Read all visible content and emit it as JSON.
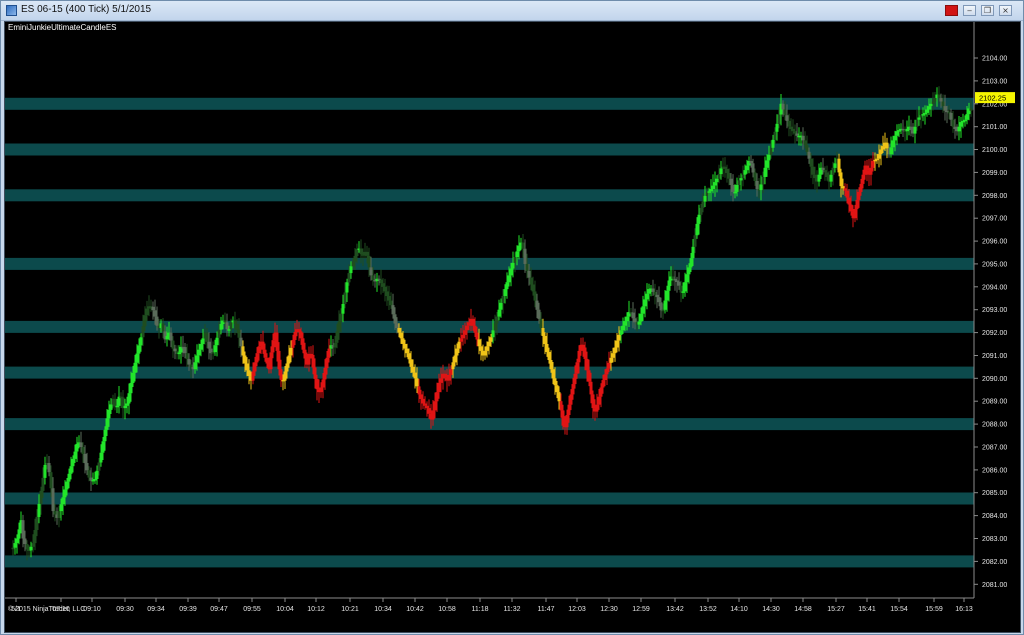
{
  "window": {
    "title": "ES 06-15 (400 Tick)  5/1/2015",
    "minimize_glyph": "‒",
    "restore_glyph": "❐",
    "close_glyph": "×",
    "accent_color": "#d11414"
  },
  "chart": {
    "indicator_label": "EminiJunkieUltimateCandleES",
    "copyright": "© 2015 NinjaTrader, LLC",
    "current_price_label": "2102.25",
    "level_band_color": "#0c4a4c",
    "background_color": "#000000",
    "price_tag_color": "#f5f500"
  },
  "chart_data": {
    "type": "candlestick",
    "instrument": "ES 06-15",
    "period": "400 Tick",
    "date": "5/1/2015",
    "y_axis": {
      "range": [
        2080.4,
        2104.7
      ],
      "ticks": [
        "2081.00",
        "2082.00",
        "2083.00",
        "2084.00",
        "2085.00",
        "2086.00",
        "2087.00",
        "2088.00",
        "2089.00",
        "2090.00",
        "2091.00",
        "2092.00",
        "2093.00",
        "2094.00",
        "2095.00",
        "2096.00",
        "2097.00",
        "2098.00",
        "2099.00",
        "2100.00",
        "2101.00",
        "2102.00",
        "2103.00",
        "2104.00"
      ]
    },
    "x_axis": {
      "ticks": [
        "5/1",
        "07:10",
        "09:10",
        "09:30",
        "09:34",
        "09:39",
        "09:47",
        "09:55",
        "10:04",
        "10:12",
        "10:21",
        "10:34",
        "10:42",
        "10:58",
        "11:18",
        "11:32",
        "11:47",
        "12:03",
        "12:30",
        "12:59",
        "13:42",
        "13:52",
        "14:10",
        "14:30",
        "14:58",
        "15:27",
        "15:41",
        "15:54",
        "15:59",
        "16:13"
      ]
    },
    "horizontal_levels": [
      2082.0,
      2084.75,
      2088.0,
      2090.25,
      2092.25,
      2095.0,
      2098.0,
      2100.0,
      2102.0
    ],
    "last_price": 2102.25,
    "path": [
      [
        0,
        2082.6
      ],
      [
        4,
        2083.0
      ],
      [
        8,
        2083.8
      ],
      [
        10,
        2083.0
      ],
      [
        15,
        2082.4
      ],
      [
        20,
        2082.8
      ],
      [
        27,
        2084.8
      ],
      [
        33,
        2086.5
      ],
      [
        37,
        2085.7
      ],
      [
        40,
        2084.2
      ],
      [
        44,
        2083.9
      ],
      [
        50,
        2084.8
      ],
      [
        57,
        2086.0
      ],
      [
        62,
        2086.8
      ],
      [
        65,
        2087.3
      ],
      [
        69,
        2086.9
      ],
      [
        72,
        2086.3
      ],
      [
        77,
        2085.5
      ],
      [
        82,
        2085.6
      ],
      [
        87,
        2086.5
      ],
      [
        91,
        2087.5
      ],
      [
        95,
        2088.5
      ],
      [
        100,
        2089.1
      ],
      [
        103,
        2088.6
      ],
      [
        107,
        2089.4
      ],
      [
        110,
        2088.7
      ],
      [
        114,
        2088.9
      ],
      [
        118,
        2089.8
      ],
      [
        123,
        2090.9
      ],
      [
        128,
        2091.8
      ],
      [
        133,
        2093.0
      ],
      [
        137,
        2093.2
      ],
      [
        141,
        2092.9
      ],
      [
        145,
        2092.1
      ],
      [
        148,
        2092.4
      ],
      [
        152,
        2091.7
      ],
      [
        156,
        2092.0
      ],
      [
        160,
        2091.3
      ],
      [
        165,
        2091.0
      ],
      [
        169,
        2091.5
      ],
      [
        172,
        2091.1
      ],
      [
        176,
        2090.6
      ],
      [
        180,
        2090.4
      ],
      [
        184,
        2091.0
      ],
      [
        188,
        2091.5
      ],
      [
        192,
        2092.0
      ],
      [
        195,
        2091.4
      ],
      [
        199,
        2091.0
      ],
      [
        203,
        2091.6
      ],
      [
        207,
        2092.3
      ],
      [
        211,
        2092.6
      ],
      [
        215,
        2092.0
      ],
      [
        219,
        2092.6
      ],
      [
        223,
        2092.3
      ],
      [
        227,
        2091.6
      ],
      [
        231,
        2090.8
      ],
      [
        235,
        2090.2
      ],
      [
        238,
        2089.9
      ],
      [
        241,
        2090.5
      ],
      [
        245,
        2091.3
      ],
      [
        248,
        2091.6
      ],
      [
        252,
        2090.9
      ],
      [
        256,
        2090.4
      ],
      [
        259,
        2091.5
      ],
      [
        262,
        2092.0
      ],
      [
        266,
        2090.4
      ],
      [
        269,
        2089.7
      ],
      [
        272,
        2090.3
      ],
      [
        276,
        2091.0
      ],
      [
        279,
        2091.5
      ],
      [
        283,
        2092.2
      ],
      [
        287,
        2092.0
      ],
      [
        291,
        2091.0
      ],
      [
        294,
        2090.6
      ],
      [
        297,
        2091.3
      ],
      [
        301,
        2090.2
      ],
      [
        305,
        2089.3
      ],
      [
        309,
        2089.7
      ],
      [
        313,
        2090.7
      ],
      [
        317,
        2091.5
      ],
      [
        321,
        2091.3
      ],
      [
        325,
        2092.3
      ],
      [
        329,
        2093.0
      ],
      [
        333,
        2094.0
      ],
      [
        337,
        2094.8
      ],
      [
        341,
        2095.2
      ],
      [
        345,
        2095.8
      ],
      [
        349,
        2095.3
      ],
      [
        353,
        2095.6
      ],
      [
        357,
        2094.6
      ],
      [
        361,
        2094.2
      ],
      [
        365,
        2094.4
      ],
      [
        370,
        2094.0
      ],
      [
        374,
        2093.6
      ],
      [
        378,
        2093.2
      ],
      [
        382,
        2092.4
      ],
      [
        386,
        2092.0
      ],
      [
        390,
        2091.5
      ],
      [
        395,
        2091.0
      ],
      [
        398,
        2090.5
      ],
      [
        402,
        2090.0
      ],
      [
        406,
        2089.3
      ],
      [
        410,
        2088.9
      ],
      [
        414,
        2088.7
      ],
      [
        418,
        2088.2
      ],
      [
        422,
        2089.0
      ],
      [
        426,
        2089.8
      ],
      [
        430,
        2090.2
      ],
      [
        434,
        2089.9
      ],
      [
        438,
        2090.4
      ],
      [
        442,
        2091.0
      ],
      [
        446,
        2091.6
      ],
      [
        450,
        2091.9
      ],
      [
        454,
        2092.3
      ],
      [
        458,
        2092.6
      ],
      [
        462,
        2092.0
      ],
      [
        466,
        2091.4
      ],
      [
        470,
        2091.0
      ],
      [
        474,
        2091.4
      ],
      [
        478,
        2091.8
      ],
      [
        482,
        2092.4
      ],
      [
        486,
        2093.0
      ],
      [
        490,
        2093.6
      ],
      [
        494,
        2094.2
      ],
      [
        498,
        2094.8
      ],
      [
        502,
        2095.3
      ],
      [
        506,
        2095.8
      ],
      [
        509,
        2096.0
      ],
      [
        512,
        2095.0
      ],
      [
        516,
        2094.4
      ],
      [
        520,
        2093.8
      ],
      [
        524,
        2093.0
      ],
      [
        528,
        2092.2
      ],
      [
        532,
        2091.5
      ],
      [
        536,
        2090.8
      ],
      [
        540,
        2090.0
      ],
      [
        544,
        2089.4
      ],
      [
        548,
        2088.6
      ],
      [
        551,
        2087.6
      ],
      [
        554,
        2088.4
      ],
      [
        558,
        2089.3
      ],
      [
        562,
        2090.2
      ],
      [
        566,
        2091.2
      ],
      [
        569,
        2091.6
      ],
      [
        573,
        2090.6
      ],
      [
        577,
        2089.6
      ],
      [
        581,
        2088.4
      ],
      [
        585,
        2089.0
      ],
      [
        589,
        2089.8
      ],
      [
        593,
        2090.3
      ],
      [
        597,
        2090.8
      ],
      [
        601,
        2091.2
      ],
      [
        605,
        2091.8
      ],
      [
        609,
        2092.2
      ],
      [
        613,
        2092.6
      ],
      [
        617,
        2093.0
      ],
      [
        621,
        2092.5
      ],
      [
        625,
        2092.3
      ],
      [
        629,
        2093.0
      ],
      [
        633,
        2093.6
      ],
      [
        637,
        2094.0
      ],
      [
        641,
        2093.7
      ],
      [
        645,
        2093.5
      ],
      [
        649,
        2092.8
      ],
      [
        653,
        2093.6
      ],
      [
        657,
        2094.5
      ],
      [
        661,
        2094.3
      ],
      [
        665,
        2094.2
      ],
      [
        669,
        2093.6
      ],
      [
        673,
        2094.4
      ],
      [
        677,
        2095.0
      ],
      [
        681,
        2096.0
      ],
      [
        685,
        2097.0
      ],
      [
        689,
        2097.6
      ],
      [
        693,
        2098.1
      ],
      [
        697,
        2098.2
      ],
      [
        701,
        2098.5
      ],
      [
        705,
        2098.8
      ],
      [
        709,
        2099.3
      ],
      [
        713,
        2099.1
      ],
      [
        717,
        2098.6
      ],
      [
        721,
        2098.0
      ],
      [
        725,
        2098.6
      ],
      [
        729,
        2098.8
      ],
      [
        733,
        2099.2
      ],
      [
        737,
        2099.6
      ],
      [
        741,
        2098.8
      ],
      [
        745,
        2098.1
      ],
      [
        749,
        2098.6
      ],
      [
        753,
        2099.4
      ],
      [
        757,
        2099.9
      ],
      [
        761,
        2100.6
      ],
      [
        765,
        2101.3
      ],
      [
        768,
        2102.0
      ],
      [
        772,
        2101.5
      ],
      [
        776,
        2101.0
      ],
      [
        780,
        2100.8
      ],
      [
        784,
        2100.6
      ],
      [
        788,
        2100.6
      ],
      [
        792,
        2100.2
      ],
      [
        796,
        2099.6
      ],
      [
        800,
        2098.9
      ],
      [
        804,
        2098.6
      ],
      [
        808,
        2099.2
      ],
      [
        812,
        2099.0
      ],
      [
        816,
        2098.6
      ],
      [
        820,
        2099.2
      ],
      [
        824,
        2099.6
      ],
      [
        828,
        2098.4
      ],
      [
        832,
        2098.2
      ],
      [
        836,
        2097.6
      ],
      [
        840,
        2097.0
      ],
      [
        844,
        2097.8
      ],
      [
        848,
        2098.5
      ],
      [
        852,
        2099.3
      ],
      [
        856,
        2098.9
      ],
      [
        860,
        2099.5
      ],
      [
        864,
        2099.6
      ],
      [
        868,
        2100.0
      ],
      [
        872,
        2100.3
      ],
      [
        876,
        2099.8
      ],
      [
        880,
        2100.4
      ],
      [
        884,
        2100.8
      ],
      [
        888,
        2100.9
      ],
      [
        892,
        2100.8
      ],
      [
        896,
        2101.0
      ],
      [
        900,
        2100.7
      ],
      [
        904,
        2101.3
      ],
      [
        908,
        2101.5
      ],
      [
        912,
        2101.6
      ],
      [
        916,
        2101.9
      ],
      [
        920,
        2102.1
      ],
      [
        924,
        2102.4
      ],
      [
        928,
        2102.1
      ],
      [
        932,
        2101.7
      ],
      [
        936,
        2101.6
      ],
      [
        940,
        2101.0
      ],
      [
        944,
        2100.8
      ],
      [
        948,
        2101.2
      ],
      [
        952,
        2101.3
      ],
      [
        956,
        2101.8
      ],
      [
        960,
        2101.6
      ],
      [
        964,
        2101.6
      ],
      [
        968,
        2102.2
      ],
      [
        971,
        2102.4
      ]
    ],
    "color_segments": [
      {
        "from": 0,
        "to": 230,
        "color": "green"
      },
      {
        "from": 230,
        "to": 240,
        "color": "yellow"
      },
      {
        "from": 240,
        "to": 270,
        "color": "red"
      },
      {
        "from": 270,
        "to": 280,
        "color": "yellow"
      },
      {
        "from": 280,
        "to": 300,
        "color": "red"
      },
      {
        "from": 300,
        "to": 318,
        "color": "red"
      },
      {
        "from": 318,
        "to": 385,
        "color": "green"
      },
      {
        "from": 385,
        "to": 405,
        "color": "yellow"
      },
      {
        "from": 405,
        "to": 440,
        "color": "red"
      },
      {
        "from": 440,
        "to": 448,
        "color": "yellow"
      },
      {
        "from": 448,
        "to": 465,
        "color": "red"
      },
      {
        "from": 465,
        "to": 480,
        "color": "yellow"
      },
      {
        "from": 480,
        "to": 530,
        "color": "green"
      },
      {
        "from": 530,
        "to": 548,
        "color": "yellow"
      },
      {
        "from": 548,
        "to": 598,
        "color": "red"
      },
      {
        "from": 598,
        "to": 608,
        "color": "yellow"
      },
      {
        "from": 608,
        "to": 825,
        "color": "green"
      },
      {
        "from": 825,
        "to": 832,
        "color": "yellow"
      },
      {
        "from": 832,
        "to": 862,
        "color": "red"
      },
      {
        "from": 862,
        "to": 875,
        "color": "yellow"
      },
      {
        "from": 875,
        "to": 972,
        "color": "green"
      }
    ],
    "series_colors": {
      "green": "#22e52a",
      "dark": "#1f4d1f",
      "yellow": "#f0c418",
      "red": "#e01414",
      "gray": "#5a6b5a"
    }
  }
}
